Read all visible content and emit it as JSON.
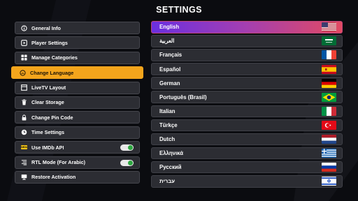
{
  "title": "SETTINGS",
  "menu": [
    {
      "label": "General Info",
      "icon": "info-icon"
    },
    {
      "label": "Player Settings",
      "icon": "play-icon"
    },
    {
      "label": "Manage Categories",
      "icon": "grid-icon"
    },
    {
      "label": "Change Language",
      "icon": "language-icon",
      "active": true
    },
    {
      "label": "LiveTV Layout",
      "icon": "layout-icon"
    },
    {
      "label": "Clear Storage",
      "icon": "trash-icon"
    },
    {
      "label": "Change Pin Code",
      "icon": "lock-icon"
    },
    {
      "label": "Time Settings",
      "icon": "clock-icon"
    },
    {
      "label": "Use IMDb API",
      "icon": "imdb-icon",
      "toggle": true
    },
    {
      "label": "RTL Mode (For Arabic)",
      "icon": "rtl-icon",
      "toggle": true
    },
    {
      "label": "Restore Activation",
      "icon": "monitor-icon"
    }
  ],
  "imdb_badge": "IMDb",
  "languages": [
    {
      "label": "English",
      "flag": "us-flag-icon",
      "selected": true
    },
    {
      "label": "العربية",
      "flag": "saudi-flag-icon"
    },
    {
      "label": "Français",
      "flag": "france-flag-icon"
    },
    {
      "label": "Español",
      "flag": "spain-flag-icon"
    },
    {
      "label": "German",
      "flag": "germany-flag-icon"
    },
    {
      "label": "Português (Brasil)",
      "flag": "brazil-flag-icon"
    },
    {
      "label": "Italian",
      "flag": "italy-flag-icon"
    },
    {
      "label": "Türkçe",
      "flag": "turkey-flag-icon"
    },
    {
      "label": "Dutch",
      "flag": "netherlands-flag-icon"
    },
    {
      "label": "Ελληνικά",
      "flag": "greece-flag-icon"
    },
    {
      "label": "Русский",
      "flag": "russia-flag-icon"
    },
    {
      "label": "עברית",
      "flag": "israel-flag-icon"
    }
  ],
  "colors": {
    "background": "#0b0c10",
    "accent": "#f4a51c",
    "selected_gradient": [
      "#6a2fe0",
      "#e24a62"
    ],
    "toggle_on": "#2da640"
  }
}
